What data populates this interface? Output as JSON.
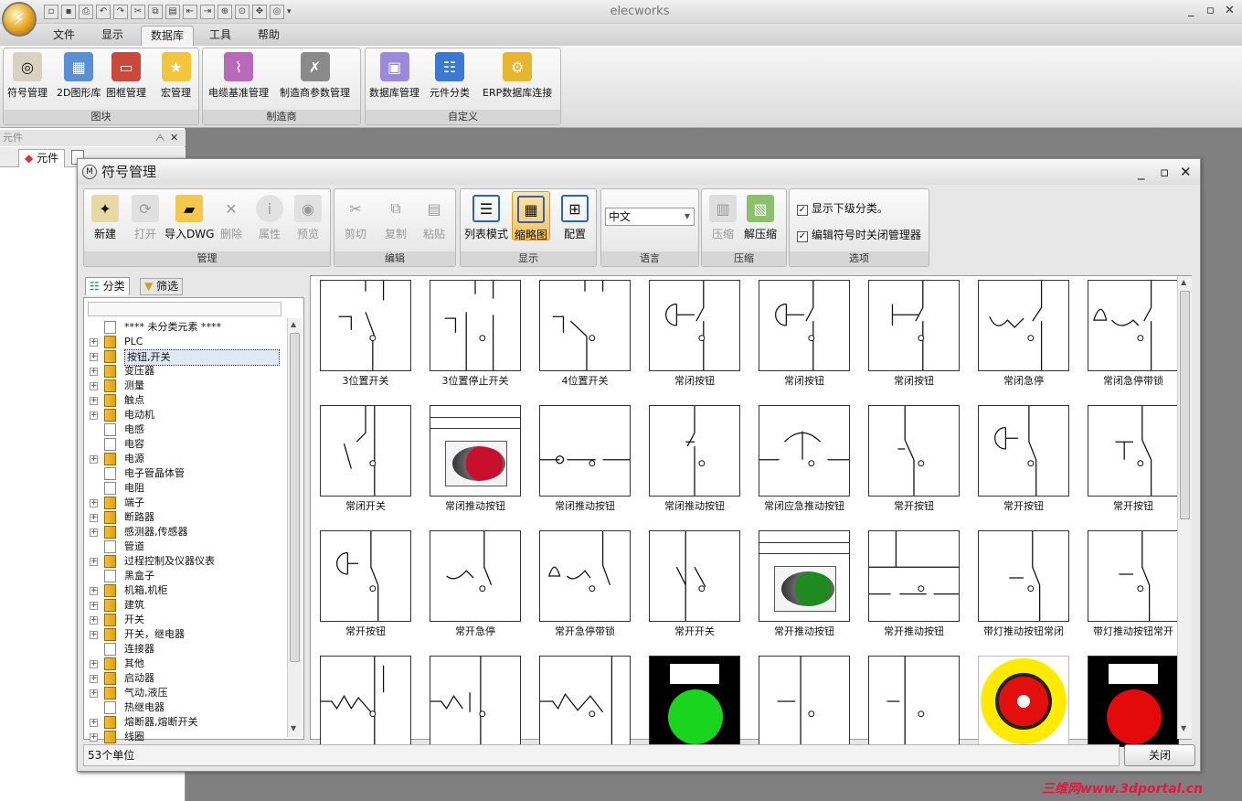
{
  "app": {
    "title": "elecworks"
  },
  "menu": {
    "tabs": [
      "文件",
      "显示",
      "数据库",
      "工具",
      "帮助"
    ],
    "active": "数据库"
  },
  "ribbon": {
    "groups": [
      {
        "caption": "图块",
        "buttons": [
          "符号管理",
          "2D图形库",
          "图框管理",
          "宏管理"
        ]
      },
      {
        "caption": "制造商",
        "buttons": [
          "电缆基准管理",
          "制造商参数管理"
        ]
      },
      {
        "caption": "自定义",
        "buttons": [
          "数据库管理",
          "元件分类",
          "ERP数据库连接"
        ]
      }
    ]
  },
  "left_panel": {
    "header": "元件",
    "tab": "元件"
  },
  "dialog": {
    "title": "符号管理",
    "toolbar": {
      "manage": {
        "caption": "管理",
        "buttons": [
          "新建",
          "打开",
          "导入DWG",
          "删除",
          "属性",
          "预览"
        ]
      },
      "edit": {
        "caption": "编辑",
        "buttons": [
          "剪切",
          "复制",
          "粘贴"
        ]
      },
      "display": {
        "caption": "显示",
        "buttons": [
          "列表模式",
          "缩略图",
          "配置"
        ],
        "active": "缩略图"
      },
      "language": {
        "caption": "语言",
        "value": "中文"
      },
      "compress": {
        "caption": "压缩",
        "buttons": [
          "压缩",
          "解压缩"
        ]
      },
      "options": {
        "caption": "选项",
        "checks": [
          {
            "label": "显示下级分类。",
            "checked": true
          },
          {
            "label": "编辑符号时关闭管理器",
            "checked": true
          }
        ]
      }
    },
    "tree_tabs": [
      "分类",
      "筛选"
    ],
    "tree": [
      {
        "label": "**** 未分类元素 ****",
        "folder": false,
        "expand": false
      },
      {
        "label": "PLC",
        "folder": true,
        "expand": true
      },
      {
        "label": "按钮,开关",
        "folder": true,
        "expand": true,
        "selected": true
      },
      {
        "label": "变压器",
        "folder": true,
        "expand": true
      },
      {
        "label": "测量",
        "folder": true,
        "expand": true
      },
      {
        "label": "触点",
        "folder": true,
        "expand": true
      },
      {
        "label": "电动机",
        "folder": true,
        "expand": true
      },
      {
        "label": "电感",
        "folder": false,
        "expand": false
      },
      {
        "label": "电容",
        "folder": false,
        "expand": false
      },
      {
        "label": "电源",
        "folder": true,
        "expand": true
      },
      {
        "label": "电子管晶体管",
        "folder": false,
        "expand": false
      },
      {
        "label": "电阻",
        "folder": false,
        "expand": false
      },
      {
        "label": "端子",
        "folder": true,
        "expand": true
      },
      {
        "label": "断路器",
        "folder": true,
        "expand": true
      },
      {
        "label": "感测器,传感器",
        "folder": true,
        "expand": true
      },
      {
        "label": "管道",
        "folder": false,
        "expand": false
      },
      {
        "label": "过程控制及仪器仪表",
        "folder": true,
        "expand": true
      },
      {
        "label": "黑盒子",
        "folder": false,
        "expand": false
      },
      {
        "label": "机箱,机柜",
        "folder": true,
        "expand": true
      },
      {
        "label": "建筑",
        "folder": true,
        "expand": true
      },
      {
        "label": "开关",
        "folder": true,
        "expand": true
      },
      {
        "label": "开关，继电器",
        "folder": true,
        "expand": true
      },
      {
        "label": "连接器",
        "folder": false,
        "expand": false
      },
      {
        "label": "其他",
        "folder": true,
        "expand": true
      },
      {
        "label": "启动器",
        "folder": true,
        "expand": true
      },
      {
        "label": "气动,液压",
        "folder": true,
        "expand": true
      },
      {
        "label": "热继电器",
        "folder": false,
        "expand": false
      },
      {
        "label": "熔断器,熔断开关",
        "folder": true,
        "expand": true
      },
      {
        "label": "线圈",
        "folder": true,
        "expand": true
      }
    ],
    "symbols": [
      "3位置开关",
      "3位置停止开关",
      "4位置开关",
      "常闭按钮",
      "常闭按钮",
      "常闭按钮",
      "常闭急停",
      "常闭急停带锁",
      "常闭开关",
      "常闭推动按钮",
      "常闭推动按钮",
      "常闭推动按钮",
      "常闭应急推动按钮",
      "常开按钮",
      "常开按钮",
      "常开按钮",
      "常开按钮",
      "常开急停",
      "常开急停带锁",
      "常开开关",
      "常开推动按钮",
      "常开推动按钮",
      "带灯推动按钮常闭",
      "带灯推动按钮常开",
      "",
      "",
      "",
      "",
      "",
      "",
      "",
      ""
    ],
    "status": "53个单位",
    "close_label": "关闭"
  },
  "watermark": "三维网www.3dportal.cn"
}
